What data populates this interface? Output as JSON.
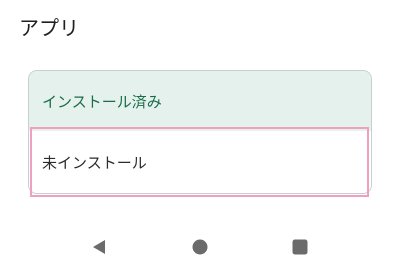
{
  "header": {
    "title": "アプリ"
  },
  "filter": {
    "options": [
      {
        "label": "インストール済み",
        "selected": true
      },
      {
        "label": "未インストール",
        "selected": false
      }
    ]
  },
  "colors": {
    "selected_bg": "#e4f1ec",
    "selected_text": "#1b6b4a",
    "focus_outline": "#ef9fc0",
    "nav_icon": "#6b6b6b"
  },
  "navbar": {
    "icons": [
      "back-icon",
      "home-icon",
      "recents-icon"
    ]
  }
}
